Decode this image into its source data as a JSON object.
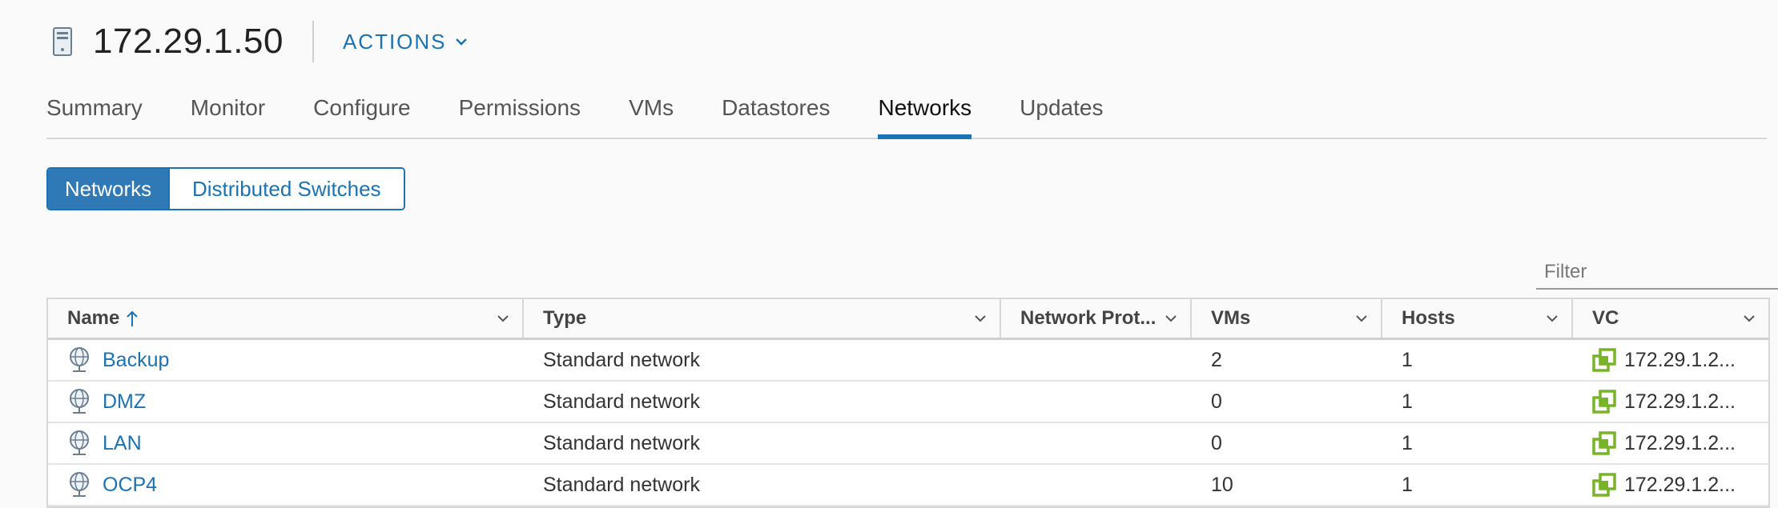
{
  "header": {
    "title": "172.29.1.50",
    "actions_label": "ACTIONS",
    "host_icon": "host-icon"
  },
  "tabs": [
    {
      "label": "Summary"
    },
    {
      "label": "Monitor"
    },
    {
      "label": "Configure"
    },
    {
      "label": "Permissions"
    },
    {
      "label": "VMs"
    },
    {
      "label": "Datastores"
    },
    {
      "label": "Networks",
      "active": true
    },
    {
      "label": "Updates"
    }
  ],
  "segmented": {
    "networks_label": "Networks",
    "switches_label": "Distributed Switches",
    "selected": "Networks"
  },
  "filter": {
    "placeholder": "Filter",
    "value": ""
  },
  "table": {
    "columns": [
      "Name",
      "Type",
      "Network Prot...",
      "VMs",
      "Hosts",
      "VC"
    ],
    "sort": {
      "column": "Name",
      "direction": "ascending"
    },
    "rows": [
      {
        "name": "Backup",
        "type": "Standard network",
        "protocol": "",
        "vms": "2",
        "hosts": "1",
        "vc": "172.29.1.2..."
      },
      {
        "name": "DMZ",
        "type": "Standard network",
        "protocol": "",
        "vms": "0",
        "hosts": "1",
        "vc": "172.29.1.2..."
      },
      {
        "name": "LAN",
        "type": "Standard network",
        "protocol": "",
        "vms": "0",
        "hosts": "1",
        "vc": "172.29.1.2..."
      },
      {
        "name": "OCP4",
        "type": "Standard network",
        "protocol": "",
        "vms": "10",
        "hosts": "1",
        "vc": "172.29.1.2..."
      }
    ]
  },
  "colors": {
    "accent": "#1a73b5",
    "vc_icon": "#78b428"
  }
}
